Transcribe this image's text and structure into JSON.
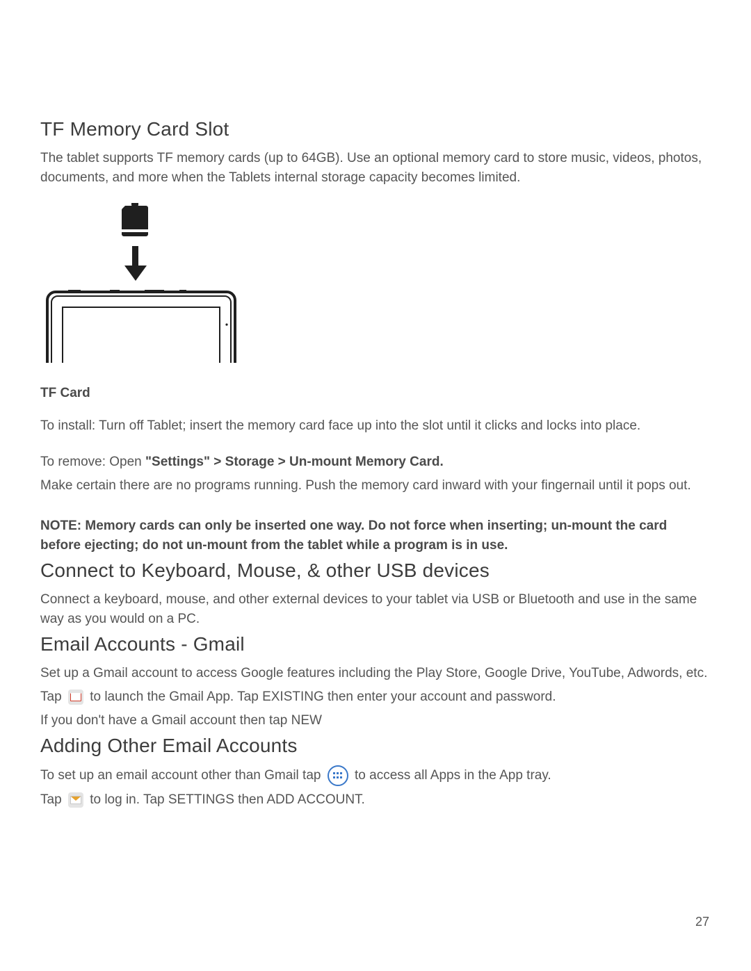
{
  "page_number": "27",
  "tf_slot": {
    "title": "TF Memory Card Slot",
    "intro": "The tablet supports TF memory cards (up to 64GB). Use an optional memory card to store music, videos, photos, documents, and more when the Tablets internal storage capacity becomes limited.",
    "sub_heading": "TF Card",
    "install": "To install: Turn off Tablet; insert the memory card face up into the slot until it clicks and locks into place.",
    "remove_prefix": "To remove: Open ",
    "remove_bold": "\"Settings\" > Storage > Un-mount Memory Card.",
    "remove_rest": "Make certain there are no programs running. Push the memory card inward with your fingernail until it pops out.",
    "note": "NOTE: Memory cards can only be inserted one way. Do not force when inserting; un-mount the card before ejecting; do not un-mount from the tablet while a program is in use."
  },
  "usb": {
    "title": "Connect to Keyboard, Mouse, & other USB devices",
    "body": "Connect a keyboard, mouse, and other external devices to your tablet via USB or Bluetooth and use in the same way as you would on a PC."
  },
  "gmail": {
    "title": "Email Accounts - Gmail",
    "body1": "Set up a Gmail account to access Google features including the Play Store, Google Drive, YouTube, Adwords, etc.",
    "tap_prefix": "Tap ",
    "tap_suffix": " to launch the Gmail App. Tap EXISTING then enter your account and password.",
    "body3": "If you don't have a Gmail account then tap NEW"
  },
  "other_email": {
    "title": "Adding Other Email Accounts",
    "line1_prefix": "To set up an email account other than Gmail tap ",
    "line1_suffix": " to access all Apps in the App tray.",
    "line2_prefix": "Tap ",
    "line2_suffix": " to log in. Tap SETTINGS then ADD ACCOUNT."
  }
}
